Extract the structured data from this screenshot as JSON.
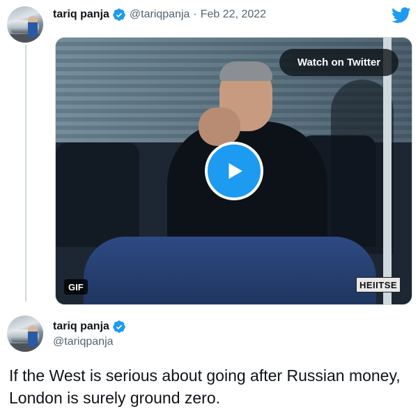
{
  "quoted_tweet": {
    "display_name": "tariq panja",
    "handle": "@tariqpanja",
    "separator": "·",
    "date": "Feb 22, 2022",
    "verified_icon": "verified-badge-icon",
    "brand_icon": "twitter-bird-icon"
  },
  "media": {
    "watch_label": "Watch on Twitter",
    "play_icon": "play-icon",
    "gif_label": "GIF",
    "watermark_text": "HEIITSE"
  },
  "tweet": {
    "display_name": "tariq panja",
    "handle": "@tariqpanja",
    "verified_icon": "verified-badge-icon",
    "text": "If the West is serious about going after Russian money, London is surely ground zero."
  },
  "colors": {
    "twitter_blue": "#1d9bf0",
    "text_primary": "#0f1419",
    "text_secondary": "#536471"
  }
}
